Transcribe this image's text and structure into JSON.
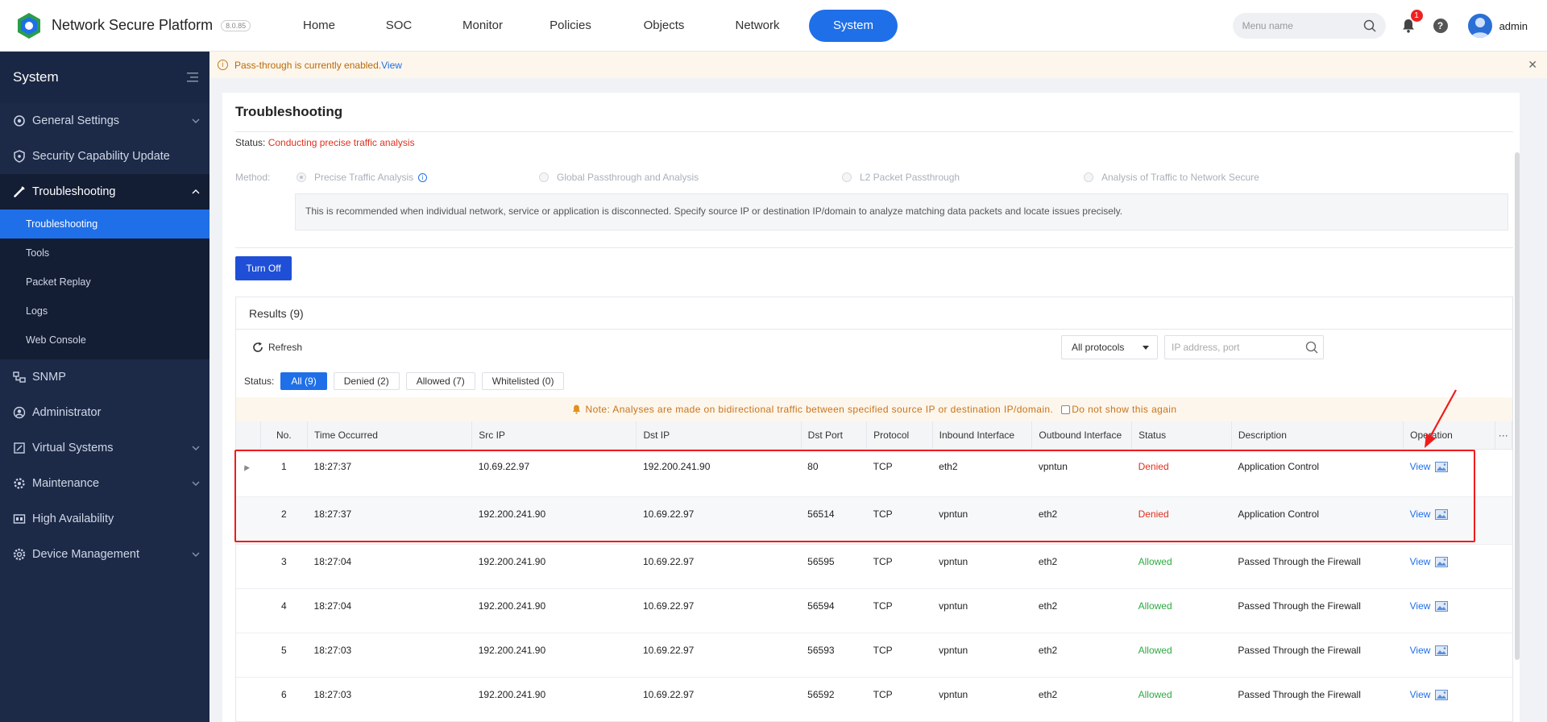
{
  "app": {
    "name": "Network Secure Platform",
    "version": "8.0.85"
  },
  "nav": {
    "items": [
      "Home",
      "SOC",
      "Monitor",
      "Policies",
      "Objects",
      "Network",
      "System"
    ],
    "active": "System"
  },
  "topbar": {
    "search_placeholder": "Menu name",
    "notification_count": "1",
    "help": "?",
    "username": "admin"
  },
  "sidebar": {
    "title": "System",
    "items": [
      {
        "label": "General Settings",
        "icon": "gear-icon",
        "expandable": true
      },
      {
        "label": "Security Capability Update",
        "icon": "shield-icon",
        "expandable": false
      },
      {
        "label": "Troubleshooting",
        "icon": "wrench-icon",
        "expandable": true,
        "open": true
      },
      {
        "label": "SNMP",
        "icon": "snmp-icon",
        "expandable": false
      },
      {
        "label": "Administrator",
        "icon": "user-icon",
        "expandable": false
      },
      {
        "label": "Virtual Systems",
        "icon": "virtual-systems-icon",
        "expandable": true
      },
      {
        "label": "Maintenance",
        "icon": "maintenance-icon",
        "expandable": true
      },
      {
        "label": "High Availability",
        "icon": "ha-icon",
        "expandable": false
      },
      {
        "label": "Device Management",
        "icon": "device-icon",
        "expandable": true
      }
    ],
    "sub_items": [
      "Troubleshooting",
      "Tools",
      "Packet Replay",
      "Logs",
      "Web Console"
    ],
    "active_sub": "Troubleshooting"
  },
  "alert": {
    "text": "Pass-through is currently enabled.",
    "link": "View"
  },
  "page": {
    "title": "Troubleshooting",
    "status_label": "Status:",
    "status_value": "Conducting precise traffic analysis",
    "method_label": "Method:",
    "methods": [
      "Precise Traffic Analysis",
      "Global Passthrough and Analysis",
      "L2 Packet Passthrough",
      "Analysis of Traffic to Network Secure"
    ],
    "method_selected": "Precise Traffic Analysis",
    "method_desc": "This is recommended when individual network, service or application is disconnected. Specify source IP or destination IP/domain to analyze matching data packets and locate issues precisely.",
    "turn_off": "Turn Off"
  },
  "results": {
    "title": "Results (9)",
    "refresh": "Refresh",
    "protocol": "All protocols",
    "search_placeholder": "IP address, port",
    "status_label": "Status:",
    "filters": [
      "All (9)",
      "Denied (2)",
      "Allowed (7)",
      "Whitelisted (0)"
    ],
    "active_filter": "All (9)",
    "note": "Note: Analyses are made on bidirectional traffic between specified source IP or destination IP/domain.",
    "note_check": "Do not show this again",
    "columns": [
      "No.",
      "Time Occurred",
      "Src IP",
      "Dst IP",
      "Dst Port",
      "Protocol",
      "Inbound Interface",
      "Outbound Interface",
      "Status",
      "Description",
      "Operation"
    ],
    "more": "···",
    "view": "View",
    "rows": [
      {
        "no": "1",
        "time": "18:27:37",
        "src": "10.69.22.97",
        "dst": "192.200.241.90",
        "port": "80",
        "proto": "TCP",
        "in": "eth2",
        "out": "vpntun",
        "status": "Denied",
        "desc": "Application Control"
      },
      {
        "no": "2",
        "time": "18:27:37",
        "src": "192.200.241.90",
        "dst": "10.69.22.97",
        "port": "56514",
        "proto": "TCP",
        "in": "vpntun",
        "out": "eth2",
        "status": "Denied",
        "desc": "Application Control"
      },
      {
        "no": "3",
        "time": "18:27:04",
        "src": "192.200.241.90",
        "dst": "10.69.22.97",
        "port": "56595",
        "proto": "TCP",
        "in": "vpntun",
        "out": "eth2",
        "status": "Allowed",
        "desc": "Passed Through the Firewall"
      },
      {
        "no": "4",
        "time": "18:27:04",
        "src": "192.200.241.90",
        "dst": "10.69.22.97",
        "port": "56594",
        "proto": "TCP",
        "in": "vpntun",
        "out": "eth2",
        "status": "Allowed",
        "desc": "Passed Through the Firewall"
      },
      {
        "no": "5",
        "time": "18:27:03",
        "src": "192.200.241.90",
        "dst": "10.69.22.97",
        "port": "56593",
        "proto": "TCP",
        "in": "vpntun",
        "out": "eth2",
        "status": "Allowed",
        "desc": "Passed Through the Firewall"
      },
      {
        "no": "6",
        "time": "18:27:03",
        "src": "192.200.241.90",
        "dst": "10.69.22.97",
        "port": "56592",
        "proto": "TCP",
        "in": "vpntun",
        "out": "eth2",
        "status": "Allowed",
        "desc": "Passed Through the Firewall"
      }
    ]
  },
  "colors": {
    "accent": "#1f6fe8",
    "sidebar_bg": "#1c2a48",
    "denied": "#e0301e",
    "allowed": "#2eaa42",
    "annotation": "#f01c1c"
  }
}
